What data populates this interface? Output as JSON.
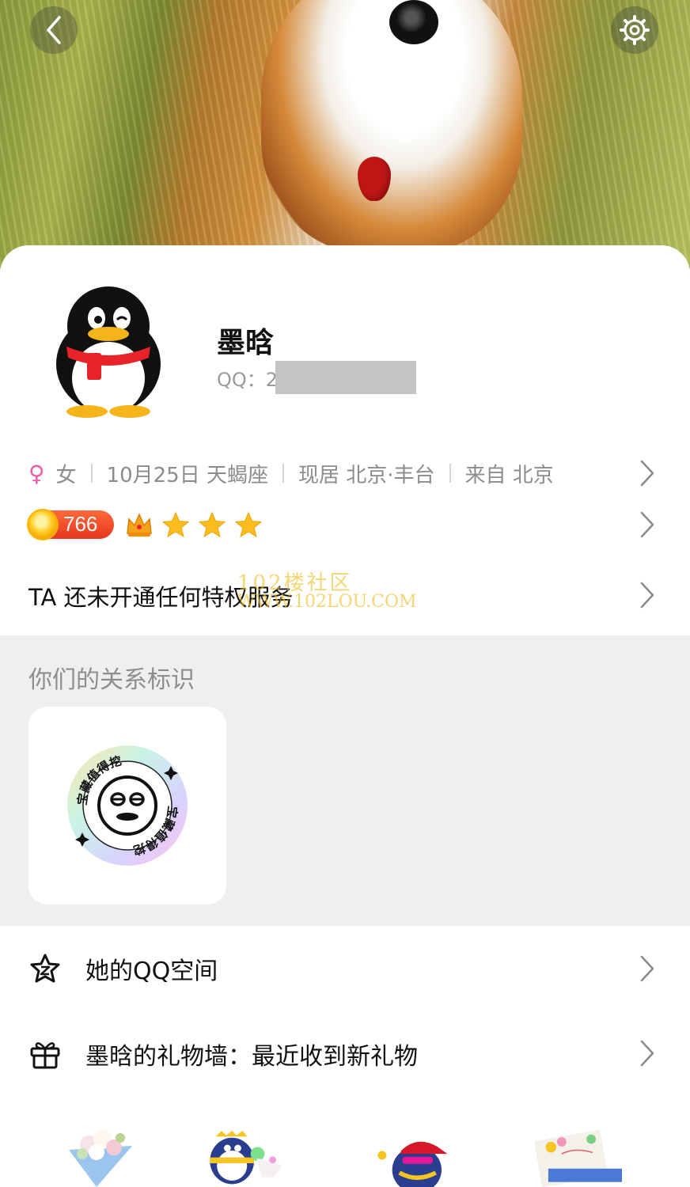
{
  "profile": {
    "name": "墨晗",
    "qq_label": "QQ：2",
    "gender": "女",
    "birthday": "10月25日 天蝎座",
    "location": "现居 北京·丰台",
    "hometown": "来自 北京",
    "level_points": "766"
  },
  "privilege_text": "TA 还未开通任何特权服务",
  "watermark": {
    "line1": "102楼社区",
    "line2": "WWW.102LOU.COM"
  },
  "relation": {
    "title": "你们的关系标识",
    "badge_text": "宝藏值得挖掘"
  },
  "menu": {
    "qzone": "她的QQ空间",
    "gift_wall": "墨晗的礼物墙：最近收到新礼物"
  },
  "icons": [
    "back-icon",
    "gear-icon",
    "female-icon",
    "coin-icon",
    "crown-icon",
    "star-icon",
    "chevron-right-icon",
    "qzone-star-icon",
    "gift-icon"
  ],
  "colors": {
    "female": "#e95ea5",
    "coin_badge": "#e7361e",
    "gray_section": "#eeeff1",
    "watermark": "#f0be28"
  }
}
